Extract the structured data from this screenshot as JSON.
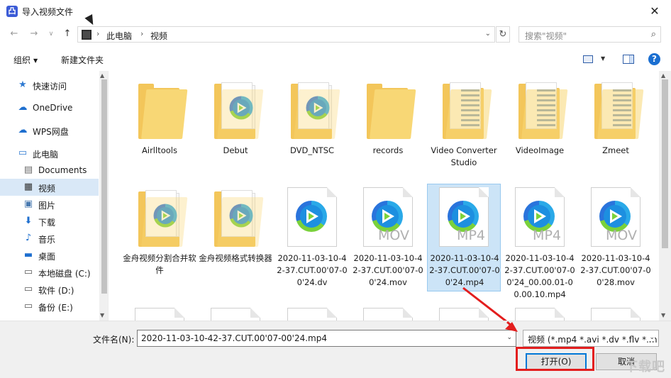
{
  "window": {
    "title": "导入视频文件",
    "close_glyph": "✕"
  },
  "navigation": {
    "breadcrumb": [
      "此电脑",
      "视频"
    ],
    "search_placeholder": "搜索\"视频\""
  },
  "toolbar": {
    "organize_label": "组织",
    "new_folder_label": "新建文件夹"
  },
  "sidebar": {
    "items": [
      {
        "label": "快速访问",
        "icon": "star-icon"
      },
      {
        "label": "OneDrive",
        "icon": "cloud-icon"
      },
      {
        "label": "WPS网盘",
        "icon": "cloud-icon"
      },
      {
        "label": "此电脑",
        "icon": "computer-icon"
      },
      {
        "label": "Documents",
        "icon": "document-icon"
      },
      {
        "label": "视频",
        "icon": "video-icon",
        "selected": true
      },
      {
        "label": "图片",
        "icon": "picture-icon"
      },
      {
        "label": "下载",
        "icon": "download-icon"
      },
      {
        "label": "音乐",
        "icon": "music-icon"
      },
      {
        "label": "桌面",
        "icon": "desktop-icon"
      },
      {
        "label": "本地磁盘 (C:)",
        "icon": "drive-icon"
      },
      {
        "label": "软件 (D:)",
        "icon": "drive-icon"
      },
      {
        "label": "备份 (E:)",
        "icon": "drive-icon"
      }
    ]
  },
  "files": [
    {
      "name": "Airlltools",
      "kind": "folder"
    },
    {
      "name": "Debut",
      "kind": "folder-video"
    },
    {
      "name": "DVD_NTSC",
      "kind": "folder-video"
    },
    {
      "name": "records",
      "kind": "folder"
    },
    {
      "name": "Video Converter Studio",
      "kind": "folder-doc"
    },
    {
      "name": "VideoImage",
      "kind": "folder-doc"
    },
    {
      "name": "Zmeet",
      "kind": "folder-doc"
    },
    {
      "name": "金舟视频分割合并软件",
      "kind": "folder-video"
    },
    {
      "name": "金舟视频格式转换器",
      "kind": "folder-video"
    },
    {
      "name": "2020-11-03-10-42-37.CUT.00'07-00'24.dv",
      "kind": "file",
      "ext": ""
    },
    {
      "name": "2020-11-03-10-42-37.CUT.00'07-00'24.mov",
      "kind": "file",
      "ext": "MOV"
    },
    {
      "name": "2020-11-03-10-42-37.CUT.00'07-00'24.mp4",
      "kind": "file",
      "ext": "MP4",
      "selected": true
    },
    {
      "name": "2020-11-03-10-42-37.CUT.00'07-00'24_00.00.01-00.00.10.mp4",
      "kind": "file",
      "ext": "MP4"
    },
    {
      "name": "2020-11-03-10-42-37.CUT.00'07-00'28.mov",
      "kind": "file",
      "ext": "MOV"
    }
  ],
  "footer": {
    "filename_label": "文件名(N):",
    "filename_value": "2020-11-03-10-42-37.CUT.00'07-00'24.mp4",
    "filetype_value": "视频 (*.mp4 *.avi *.dv *.flv *.m",
    "open_label": "打开(O)",
    "cancel_label": "取消",
    "watermark": "下载吧"
  },
  "colors": {
    "accent": "#0078d7",
    "annotation": "#e31e1e",
    "selection": "#cce4f7"
  }
}
